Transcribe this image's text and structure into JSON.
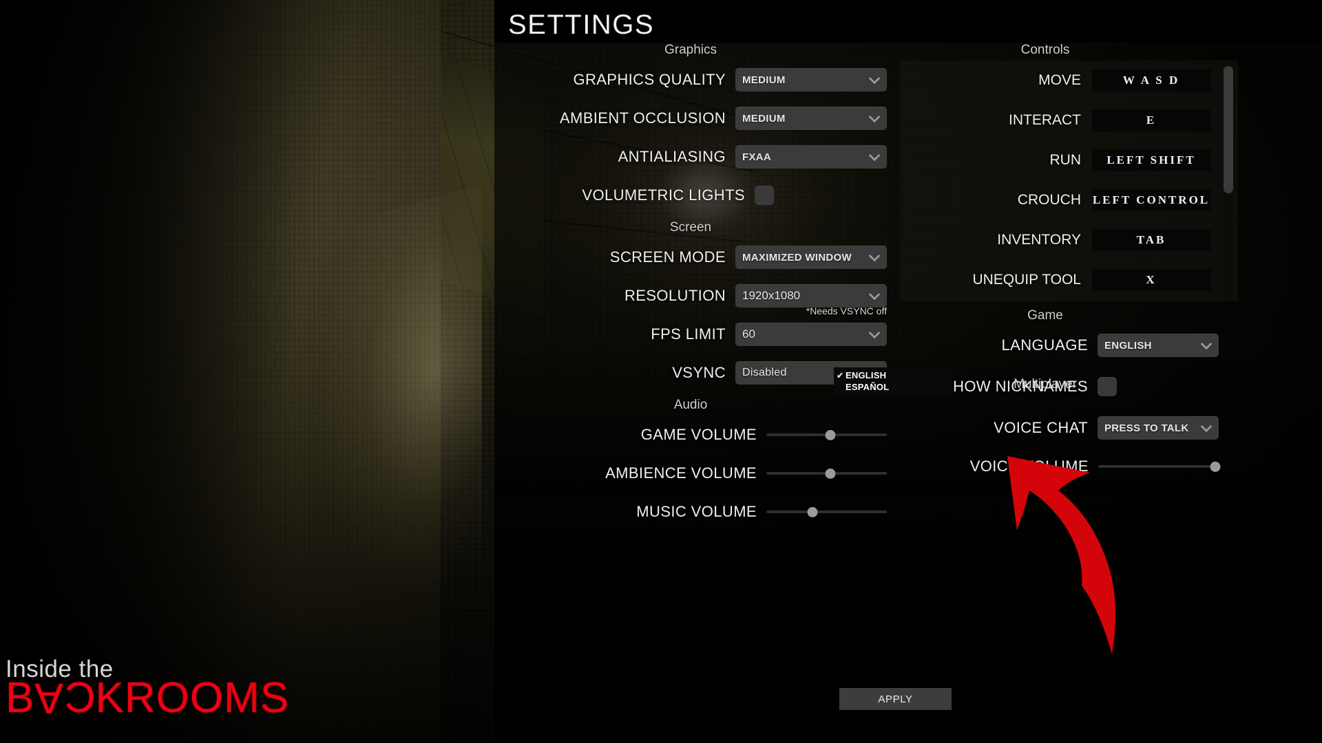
{
  "window": {
    "title": "SETTINGS"
  },
  "sections": {
    "graphics": "Graphics",
    "screen": "Screen",
    "audio": "Audio",
    "controls": "Controls",
    "game": "Game",
    "multiplayer": "Multiplayer"
  },
  "graphics": {
    "quality": {
      "label": "GRAPHICS QUALITY",
      "value": "MEDIUM"
    },
    "ambient_occlusion": {
      "label": "AMBIENT OCCLUSION",
      "value": "MEDIUM"
    },
    "antialiasing": {
      "label": "ANTIALIASING",
      "value": "FXAA"
    },
    "volumetric_lights": {
      "label": "VOLUMETRIC LIGHTS",
      "checked": false
    }
  },
  "screen": {
    "screen_mode": {
      "label": "SCREEN MODE",
      "value": "MAXIMIZED WINDOW"
    },
    "resolution": {
      "label": "RESOLUTION",
      "value": "1920x1080"
    },
    "fps_limit": {
      "label": "FPS LIMIT",
      "value": "60",
      "note": "*Needs VSYNC off"
    },
    "vsync": {
      "label": "VSYNC",
      "value": "Disabled"
    }
  },
  "audio": {
    "game_volume": {
      "label": "GAME VOLUME",
      "percent": 53
    },
    "ambience_volume": {
      "label": "AMBIENCE VOLUME",
      "percent": 53
    },
    "music_volume": {
      "label": "MUSIC VOLUME",
      "percent": 38
    }
  },
  "controls": [
    {
      "label": "MOVE",
      "key": "W A S D"
    },
    {
      "label": "INTERACT",
      "key": "E"
    },
    {
      "label": "RUN",
      "key": "LEFT SHIFT"
    },
    {
      "label": "CROUCH",
      "key": "LEFT CONTROL"
    },
    {
      "label": "INVENTORY",
      "key": "TAB"
    },
    {
      "label": "UNEQUIP TOOL",
      "key": "X"
    }
  ],
  "game": {
    "language": {
      "label": "LANGUAGE",
      "value": "ENGLISH",
      "open": true,
      "options": [
        {
          "label": "ENGLISH",
          "selected": true
        },
        {
          "label": "ESPAÑOL",
          "selected": false
        }
      ]
    }
  },
  "multiplayer": {
    "show_nicknames": {
      "label": "SHOW NICKNAMES",
      "checked": false
    },
    "voice_chat": {
      "label": "VOICE CHAT",
      "value": "PRESS TO TALK"
    },
    "voice_volume": {
      "label": "VOICE VOLUME",
      "percent": 97
    }
  },
  "footer": {
    "apply": "APPLY"
  },
  "logo": {
    "line1": "Inside the",
    "line2": "BACKROOMS"
  },
  "annotation": {
    "type": "curved-arrow",
    "color": "#d4050a",
    "points_to": "ESPAÑOL"
  },
  "colors": {
    "accent_red": "#f00012",
    "control_bg": "#3b3b3b",
    "panel_bg": "#030303",
    "text": "#efefef"
  }
}
